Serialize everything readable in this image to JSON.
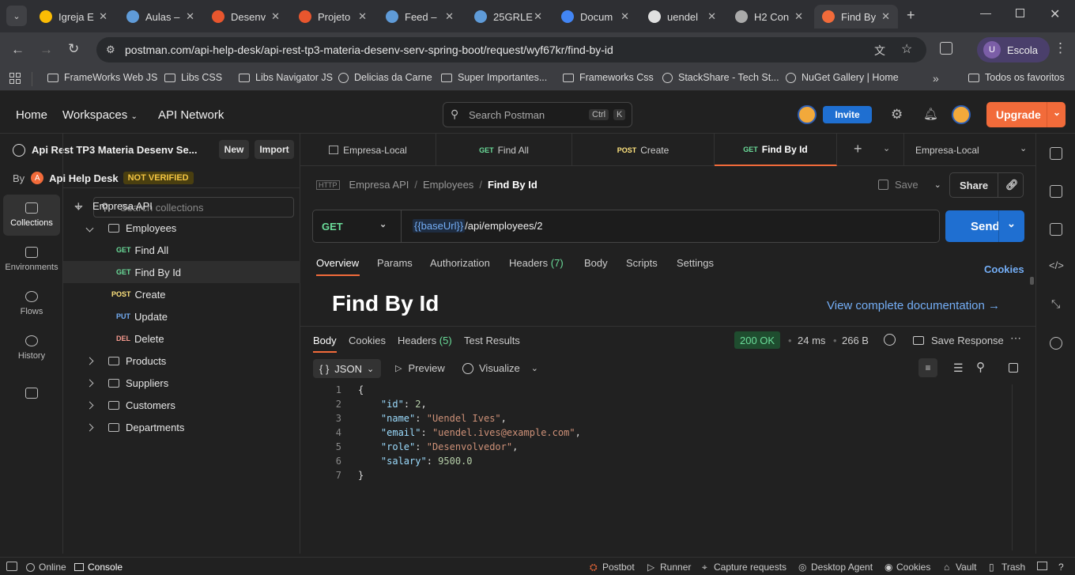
{
  "browser": {
    "tabs": [
      {
        "title": "Igreja E",
        "color": "#fbbc04"
      },
      {
        "title": "Aulas –",
        "color": "#5f9bd8"
      },
      {
        "title": "Desenv",
        "color": "#e8562e"
      },
      {
        "title": "Projeto",
        "color": "#e8562e"
      },
      {
        "title": "Feed –",
        "color": "#5f9bd8"
      },
      {
        "title": "25GRLE",
        "color": "#5f9bd8"
      },
      {
        "title": "Docum",
        "color": "#4285f4"
      },
      {
        "title": "uendel",
        "color": "#e0e0e0"
      },
      {
        "title": "H2 Con",
        "color": "#aaaaaa"
      },
      {
        "title": "Find By",
        "color": "#f26b3a"
      }
    ],
    "url": "postman.com/api-help-desk/api-rest-tp3-materia-desenv-serv-spring-boot/request/wyf67kr/find-by-id",
    "profile": "Escola",
    "profile_initial": "U",
    "bookmarks": [
      "FrameWorks Web JS",
      "Libs CSS",
      "Libs Navigator JS",
      "Delicias da Carne",
      "Super Importantes...",
      "Frameworks Css",
      "StackShare - Tech St...",
      "NuGet Gallery | Home",
      "Todos os favoritos"
    ]
  },
  "header": {
    "nav": [
      "Home",
      "Workspaces",
      "API Network"
    ],
    "search_placeholder": "Search Postman",
    "kbd_ctrl": "Ctrl",
    "kbd_k": "K",
    "invite": "Invite",
    "upgrade": "Upgrade"
  },
  "sidebar": {
    "workspace": "Api Rest TP3 Materia Desenv Se...",
    "new": "New",
    "import": "Import",
    "by": "By",
    "owner": "Api Help Desk",
    "badge": "NOT VERIFIED",
    "search_placeholder": "Search collections",
    "rail": [
      "Collections",
      "Environments",
      "Flows",
      "History"
    ],
    "tree": [
      {
        "label": "Empresa API",
        "type": "collection"
      },
      {
        "label": "Employees",
        "type": "folder-open"
      },
      {
        "label": "Find All",
        "method": "GET"
      },
      {
        "label": "Find By Id",
        "method": "GET",
        "selected": true
      },
      {
        "label": "Create",
        "method": "POST"
      },
      {
        "label": "Update",
        "method": "PUT"
      },
      {
        "label": "Delete",
        "method": "DEL"
      },
      {
        "label": "Products",
        "type": "folder"
      },
      {
        "label": "Suppliers",
        "type": "folder"
      },
      {
        "label": "Customers",
        "type": "folder"
      },
      {
        "label": "Departments",
        "type": "folder"
      }
    ]
  },
  "request_tabs": [
    {
      "method": "",
      "label": "Empresa-Local"
    },
    {
      "method": "GET",
      "label": "Find All"
    },
    {
      "method": "POST",
      "label": "Create"
    },
    {
      "method": "GET",
      "label": "Find By Id"
    }
  ],
  "environment": "Empresa-Local",
  "breadcrumb": {
    "root": "Empresa API",
    "folder": "Employees",
    "current": "Find By Id"
  },
  "actions": {
    "save": "Save",
    "share": "Share"
  },
  "request": {
    "method": "GET",
    "var": "{{baseUrl}}",
    "path": " /api/employees/2",
    "send": "Send"
  },
  "req_tabs": [
    "Overview",
    "Params",
    "Authorization",
    "Headers",
    "Body",
    "Scripts",
    "Settings"
  ],
  "headers_count": "(7)",
  "cookies": "Cookies",
  "overview": {
    "title": "Find By Id",
    "doc_link": "View complete documentation →"
  },
  "response": {
    "tabs": [
      "Body",
      "Cookies",
      "Headers",
      "Test Results"
    ],
    "headers_count": "(5)",
    "status": "200 OK",
    "time": "24 ms",
    "size": "266 B",
    "save_response": "Save Response",
    "format": "JSON",
    "preview": "Preview",
    "visualize": "Visualize",
    "lines": [
      {
        "num": "1",
        "text": "{"
      },
      {
        "num": "2",
        "key": "\"id\"",
        "value": "2",
        "vtype": "n",
        "comma": ","
      },
      {
        "num": "3",
        "key": "\"name\"",
        "value": "\"Uendel Ives\"",
        "vtype": "s",
        "comma": ","
      },
      {
        "num": "4",
        "key": "\"email\"",
        "value": "\"uendel.ives@example.com\"",
        "vtype": "s",
        "comma": ","
      },
      {
        "num": "5",
        "key": "\"role\"",
        "value": "\"Desenvolvedor\"",
        "vtype": "s",
        "comma": ","
      },
      {
        "num": "6",
        "key": "\"salary\"",
        "value": "9500.0",
        "vtype": "n",
        "comma": ""
      },
      {
        "num": "7",
        "text": "}"
      }
    ]
  },
  "status_bar": [
    "Online",
    "Console",
    "Postbot",
    "Runner",
    "Capture requests",
    "Desktop Agent",
    "Cookies",
    "Vault",
    "Trash"
  ]
}
